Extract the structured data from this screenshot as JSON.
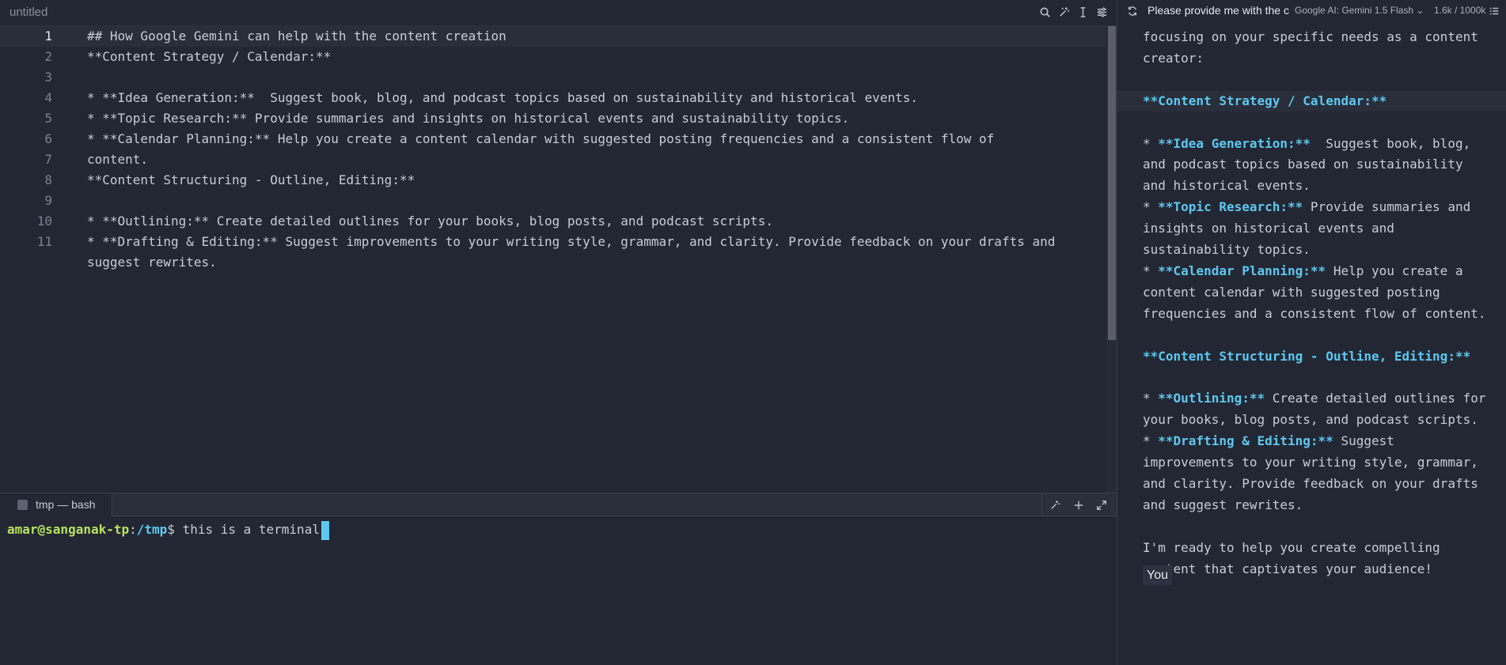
{
  "editor": {
    "title": "untitled",
    "toolbar_icons": [
      "search-icon",
      "magic-wand-icon",
      "text-cursor-icon",
      "sliders-icon"
    ],
    "lines": [
      {
        "num": "1",
        "text": "## How Google Gemini can help with the content creation"
      },
      {
        "num": "2",
        "text": "**Content Strategy / Calendar:**"
      },
      {
        "num": "3",
        "text": ""
      },
      {
        "num": "4",
        "text": "* **Idea Generation:**  Suggest book, blog, and podcast topics based on sustainability and historical events."
      },
      {
        "num": "5",
        "text": "* **Topic Research:** Provide summaries and insights on historical events and sustainability topics."
      },
      {
        "num": "6",
        "text": "* **Calendar Planning:** Help you create a content calendar with suggested posting frequencies and a consistent flow of content."
      },
      {
        "num": "7",
        "text": ""
      },
      {
        "num": "8",
        "text": "**Content Structuring - Outline, Editing:**"
      },
      {
        "num": "9",
        "text": ""
      },
      {
        "num": "10",
        "text": "* **Outlining:** Create detailed outlines for your books, blog posts, and podcast scripts."
      },
      {
        "num": "11",
        "text": "* **Drafting & Editing:** Suggest improvements to your writing style, grammar, and clarity. Provide feedback on your drafts and suggest rewrites."
      }
    ]
  },
  "terminal": {
    "tab_label": "tmp — bash",
    "prompt_user": "amar@sanganak-tp",
    "prompt_sep": ":",
    "prompt_path": "/tmp",
    "prompt_end": "$ ",
    "command": "this is a terminal",
    "action_icons": [
      "magic-wand-icon",
      "plus-icon",
      "expand-icon"
    ]
  },
  "chat": {
    "title": "Please provide me with the c",
    "model": "Google AI: Gemini 1.5 Flash",
    "tokens": "1.6k / 1000k",
    "lines": [
      {
        "parts": [
          {
            "t": "focusing on your specific needs as a content"
          }
        ]
      },
      {
        "parts": [
          {
            "t": "creator:"
          }
        ]
      },
      {
        "parts": []
      },
      {
        "highlight": true,
        "parts": [
          {
            "t": "**Content Strategy / Calendar:**",
            "kw": true
          }
        ]
      },
      {
        "parts": []
      },
      {
        "parts": [
          {
            "t": "* "
          },
          {
            "t": "**Idea Generation:**",
            "kw": true
          },
          {
            "t": "  Suggest book, blog,"
          }
        ]
      },
      {
        "parts": [
          {
            "t": "and podcast topics based on sustainability"
          }
        ]
      },
      {
        "parts": [
          {
            "t": "and historical events."
          }
        ]
      },
      {
        "parts": [
          {
            "t": "* "
          },
          {
            "t": "**Topic Research:**",
            "kw": true
          },
          {
            "t": " Provide summaries and"
          }
        ]
      },
      {
        "parts": [
          {
            "t": "insights on historical events and"
          }
        ]
      },
      {
        "parts": [
          {
            "t": "sustainability topics."
          }
        ]
      },
      {
        "parts": [
          {
            "t": "* "
          },
          {
            "t": "**Calendar Planning:**",
            "kw": true
          },
          {
            "t": " Help you create a"
          }
        ]
      },
      {
        "parts": [
          {
            "t": "content calendar with suggested posting"
          }
        ]
      },
      {
        "parts": [
          {
            "t": "frequencies and a consistent flow of content."
          }
        ]
      },
      {
        "parts": []
      },
      {
        "parts": [
          {
            "t": "**Content Structuring - Outline, Editing:**",
            "kw": true
          }
        ]
      },
      {
        "parts": []
      },
      {
        "parts": [
          {
            "t": "* "
          },
          {
            "t": "**Outlining:**",
            "kw": true
          },
          {
            "t": " Create detailed outlines for"
          }
        ]
      },
      {
        "parts": [
          {
            "t": "your books, blog posts, and podcast scripts."
          }
        ]
      },
      {
        "parts": [
          {
            "t": "* "
          },
          {
            "t": "**Drafting & Editing:**",
            "kw": true
          },
          {
            "t": " Suggest"
          }
        ]
      },
      {
        "parts": [
          {
            "t": "improvements to your writing style, grammar,"
          }
        ]
      },
      {
        "parts": [
          {
            "t": "and clarity. Provide feedback on your drafts"
          }
        ]
      },
      {
        "parts": [
          {
            "t": "and suggest rewrites."
          }
        ]
      },
      {
        "parts": []
      },
      {
        "parts": [
          {
            "t": "I'm ready to help you create compelling"
          }
        ]
      },
      {
        "parts": [
          {
            "t": "content that captivates your audience!"
          }
        ]
      }
    ],
    "you_label": "You"
  },
  "colors": {
    "background": "#232733",
    "keyword": "#5cc8f0",
    "prompt_user": "#b8e060",
    "cursor": "#5cc8f0"
  }
}
